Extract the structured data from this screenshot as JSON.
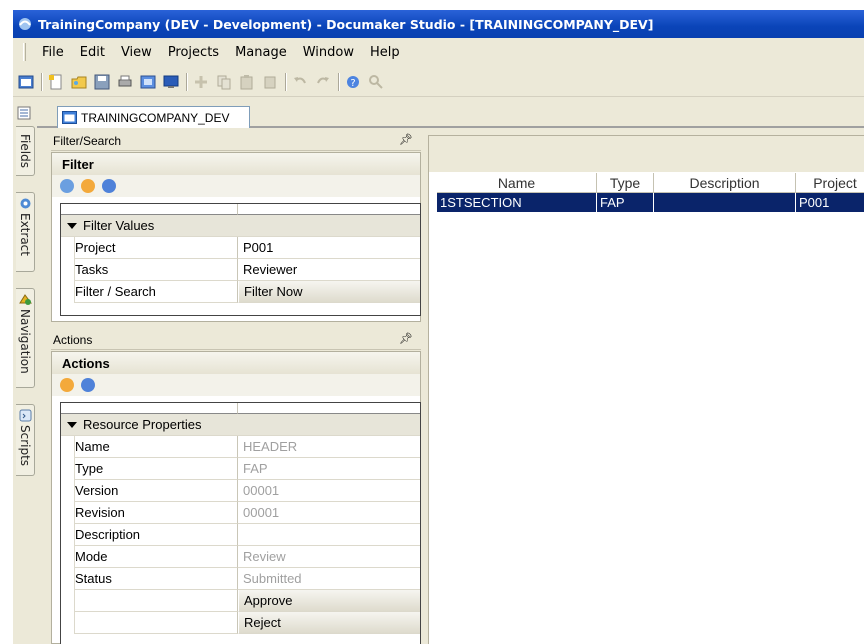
{
  "window": {
    "title": "TrainingCompany (DEV - Development) - Documaker Studio - [TRAININGCOMPANY_DEV]"
  },
  "menu": [
    "File",
    "Edit",
    "View",
    "Projects",
    "Manage",
    "Window",
    "Help"
  ],
  "side_tabs": [
    "Fields",
    "Extract",
    "Navigation",
    "Scripts"
  ],
  "doc_tab": "TRAININGCOMPANY_DEV",
  "filter_panel": {
    "header": "Filter/Search",
    "title": "Filter",
    "section": "Filter Values",
    "rows": [
      {
        "label": "Project",
        "value": "P001"
      },
      {
        "label": "Tasks",
        "value": "Reviewer"
      },
      {
        "label": "Filter / Search",
        "value": "Filter Now"
      }
    ]
  },
  "actions_panel": {
    "header": "Actions",
    "title": "Actions",
    "section": "Resource Properties",
    "rows": [
      {
        "label": "Name",
        "value": "HEADER"
      },
      {
        "label": "Type",
        "value": "FAP"
      },
      {
        "label": "Version",
        "value": "00001"
      },
      {
        "label": "Revision",
        "value": "00001"
      },
      {
        "label": "Description",
        "value": ""
      },
      {
        "label": "Mode",
        "value": "Review"
      },
      {
        "label": "Status",
        "value": "Submitted"
      },
      {
        "label": "",
        "value": "Approve"
      },
      {
        "label": "",
        "value": "Reject"
      }
    ]
  },
  "list": {
    "columns": [
      "Name",
      "Type",
      "Description",
      "Project"
    ],
    "rows": [
      {
        "name": "1STSECTION",
        "type": "FAP",
        "description": "",
        "project": "P001"
      }
    ]
  },
  "colors": {
    "titlebar": "#0a44b8",
    "selection": "#0a246a",
    "chrome": "#ece9d8"
  }
}
